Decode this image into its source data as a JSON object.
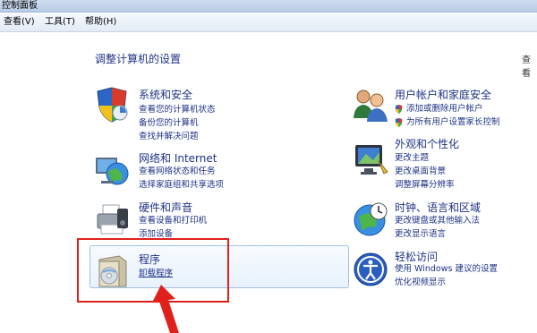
{
  "window": {
    "title": "控制面板"
  },
  "menu": [
    "查看(V)",
    "工具(T)",
    "帮助(H)"
  ],
  "page": {
    "title": "调整计算机的设置",
    "view_label": "查看"
  },
  "categories": {
    "system": {
      "title": "系统和安全",
      "links": [
        "查看您的计算机状态",
        "备份您的计算机",
        "查找并解决问题"
      ],
      "icon": "shield-icon"
    },
    "network": {
      "title": "网络和 Internet",
      "links": [
        "查看网络状态和任务",
        "选择家庭组和共享选项"
      ],
      "icon": "globe-network-icon"
    },
    "hardware": {
      "title": "硬件和声音",
      "links": [
        "查看设备和打印机",
        "添加设备"
      ],
      "icon": "printer-icon"
    },
    "programs": {
      "title": "程序",
      "links": [
        "卸载程序"
      ],
      "icon": "programs-box-icon"
    },
    "users": {
      "title": "用户帐户和家庭安全",
      "links": [
        "添加或删除用户帐户",
        "为所有用户设置家长控制"
      ],
      "icon": "users-icon"
    },
    "appearance": {
      "title": "外观和个性化",
      "links": [
        "更改主题",
        "更改桌面背景",
        "调整屏幕分辨率"
      ],
      "icon": "monitor-icon"
    },
    "clock": {
      "title": "时钟、语言和区域",
      "links": [
        "更改键盘或其他输入法",
        "更改显示语言"
      ],
      "icon": "clock-globe-icon"
    },
    "ease": {
      "title": "轻松访问",
      "links": [
        "使用 Windows 建议的设置",
        "优化视频显示"
      ],
      "icon": "ease-of-access-icon"
    }
  },
  "annotation_color": "#e0211b"
}
